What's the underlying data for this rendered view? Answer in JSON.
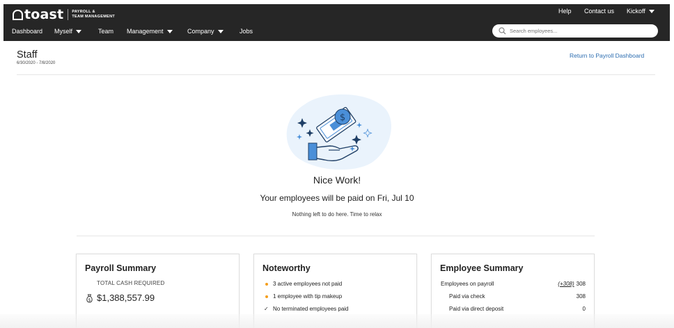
{
  "brand": {
    "word": "toast",
    "sub_line1": "PAYROLL &",
    "sub_line2": "TEAM MANAGEMENT"
  },
  "utility_nav": {
    "help": "Help",
    "contact": "Contact us",
    "account": "Kickoff"
  },
  "nav": {
    "dashboard": "Dashboard",
    "myself": "Myself",
    "team": "Team",
    "management": "Management",
    "company": "Company",
    "jobs": "Jobs"
  },
  "search": {
    "placeholder": "Search employees..."
  },
  "page": {
    "title": "Staff",
    "dates": "6/30/2020 - 7/8/2020",
    "return_link": "Return to Payroll Dashboard"
  },
  "hero": {
    "title": "Nice Work!",
    "subtitle": "Your employees will be paid on Fri, Jul 10",
    "note": "Nothing left to do here. Time to relax"
  },
  "payroll_summary": {
    "title": "Payroll Summary",
    "label": "TOTAL CASH REQUIRED",
    "amount": "$1,388,557.99"
  },
  "noteworthy": {
    "title": "Noteworthy",
    "items": [
      {
        "text": "3 active employees not paid",
        "marker": "dot"
      },
      {
        "text": "1 employee with tip makeup",
        "marker": "dot"
      },
      {
        "text": "No terminated employees paid",
        "marker": "check"
      }
    ]
  },
  "employee_summary": {
    "title": "Employee Summary",
    "rows": [
      {
        "label": "Employees on payroll",
        "delta": "(+308)",
        "value": "308"
      },
      {
        "label": "Paid via check",
        "delta": "",
        "value": "308"
      },
      {
        "label": "Paid via direct deposit",
        "delta": "",
        "value": "0"
      }
    ]
  },
  "colors": {
    "topbar": "#262626",
    "link": "#2b6cb0",
    "accent_dot": "#f59e1c",
    "illustration_blue": "#4a8fd8",
    "illustration_bg": "#eaf3fc"
  }
}
